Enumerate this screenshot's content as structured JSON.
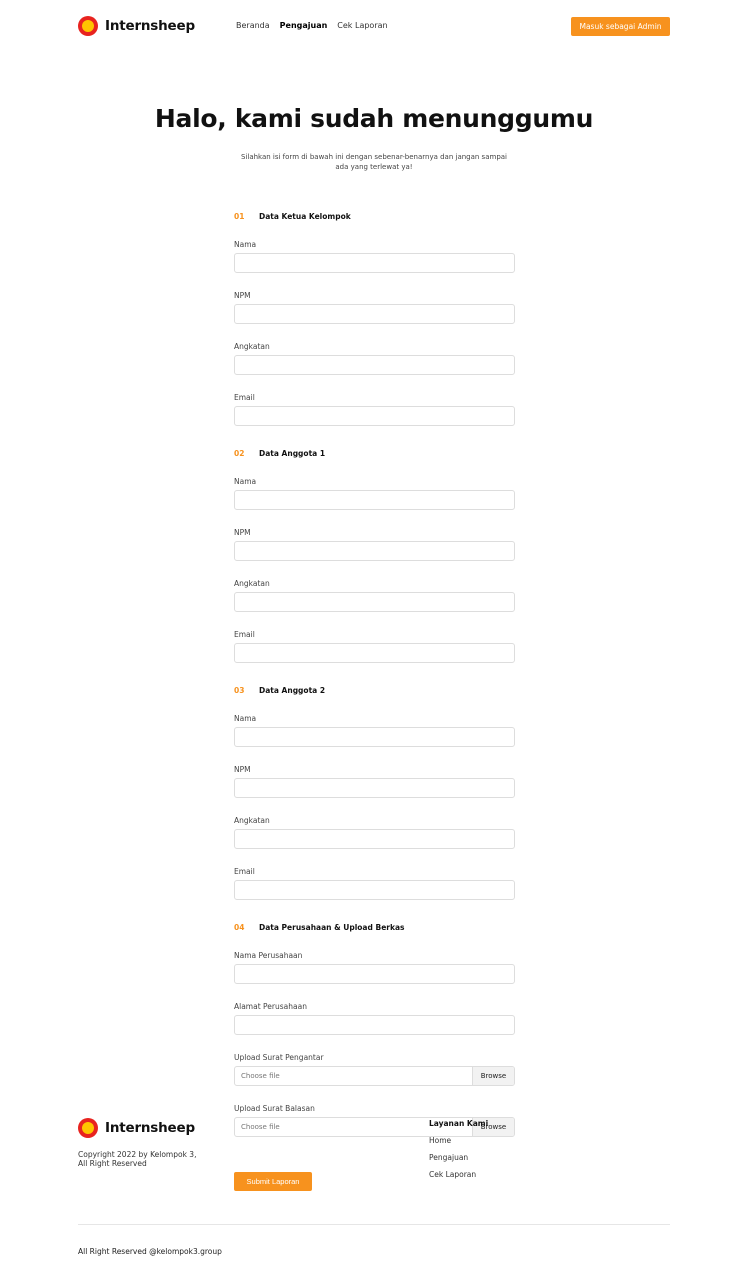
{
  "brand": {
    "name": "Internsheep"
  },
  "nav": {
    "items": [
      "Beranda",
      "Pengajuan",
      "Cek Laporan"
    ],
    "active": "Pengajuan",
    "admin_button": "Masuk sebagai Admin"
  },
  "hero": {
    "title": "Halo, kami sudah menunggumu",
    "subtitle": "Silahkan isi form di bawah ini dengan sebenar-benarnya dan jangan sampai ada yang terlewat ya!"
  },
  "form": {
    "sections": [
      {
        "number": "01",
        "title": "Data Ketua Kelompok",
        "fields": [
          {
            "label": "Nama",
            "value": ""
          },
          {
            "label": "NPM",
            "value": ""
          },
          {
            "label": "Angkatan",
            "value": ""
          },
          {
            "label": "Email",
            "value": ""
          }
        ]
      },
      {
        "number": "02",
        "title": "Data Anggota 1",
        "fields": [
          {
            "label": "Nama",
            "value": ""
          },
          {
            "label": "NPM",
            "value": ""
          },
          {
            "label": "Angkatan",
            "value": ""
          },
          {
            "label": "Email",
            "value": ""
          }
        ]
      },
      {
        "number": "03",
        "title": "Data Anggota 2",
        "fields": [
          {
            "label": "Nama",
            "value": ""
          },
          {
            "label": "NPM",
            "value": ""
          },
          {
            "label": "Angkatan",
            "value": ""
          },
          {
            "label": "Email",
            "value": ""
          }
        ]
      },
      {
        "number": "04",
        "title": "Data Perusahaan & Upload Berkas",
        "fields": [
          {
            "label": "Nama Perusahaan",
            "value": ""
          },
          {
            "label": "Alamat Perusahaan",
            "value": ""
          }
        ],
        "uploads": [
          {
            "label": "Upload Surat Pengantar",
            "placeholder": "Choose file",
            "button": "Browse"
          },
          {
            "label": "Upload Surat Balasan",
            "placeholder": "Choose file",
            "button": "Browse"
          }
        ]
      }
    ],
    "submit_label": "Submit Laporan"
  },
  "footer": {
    "copyright_line1": "Copyright 2022 by Kelompok 3,",
    "copyright_line2": "All Right Reserved",
    "services_title": "Layanan Kami",
    "services": [
      "Home",
      "Pengajuan",
      "Cek Laporan"
    ],
    "bottom": "All Right Reserved @kelompok3.group"
  },
  "colors": {
    "accent": "#f7921e",
    "logo_outer": "#e8231f",
    "logo_inner": "#ffc400"
  },
  "icons": {
    "logo": "sun-logo-icon"
  }
}
